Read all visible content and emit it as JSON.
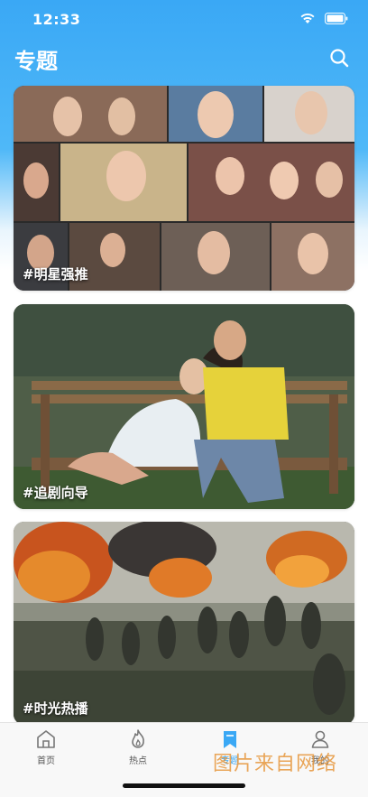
{
  "status_bar": {
    "time": "12:33"
  },
  "header": {
    "title": "专题",
    "search_icon": "search-icon"
  },
  "cards": [
    {
      "label": "#明星强推"
    },
    {
      "label": "#追剧向导"
    },
    {
      "label": "#时光热播"
    }
  ],
  "tab_bar": {
    "tabs": [
      {
        "label": "首页",
        "icon": "home-icon"
      },
      {
        "label": "热点",
        "icon": "flame-icon"
      },
      {
        "label": "专题",
        "icon": "bookmark-icon"
      },
      {
        "label": "我的",
        "icon": "person-icon"
      }
    ],
    "active_color": "#3aa8f5"
  },
  "watermark": "图片来自网络",
  "colors": {
    "accent": "#3aa8f5"
  }
}
